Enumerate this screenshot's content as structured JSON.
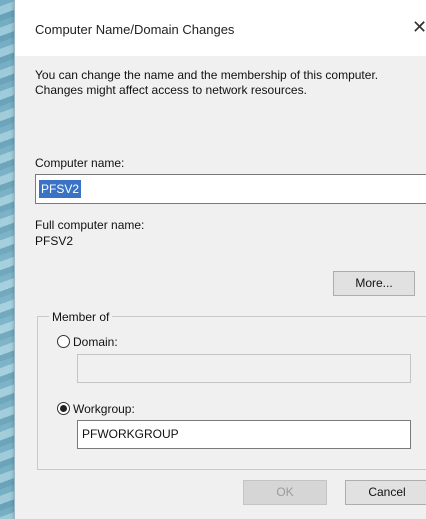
{
  "dialog": {
    "title": "Computer Name/Domain Changes",
    "close_glyph": "✕",
    "description": "You can change the name and the membership of this computer. Changes might affect access to network resources."
  },
  "computer_name": {
    "label": "Computer name:",
    "value": "PFSV2"
  },
  "full_name": {
    "label": "Full computer name:",
    "value": "PFSV2"
  },
  "more_button": "More...",
  "member_of": {
    "legend": "Member of",
    "domain_label": "Domain:",
    "domain_value": "",
    "domain_selected": false,
    "workgroup_label": "Workgroup:",
    "workgroup_value": "PFWORKGROUP",
    "workgroup_selected": true
  },
  "buttons": {
    "ok": "OK",
    "cancel": "Cancel"
  }
}
